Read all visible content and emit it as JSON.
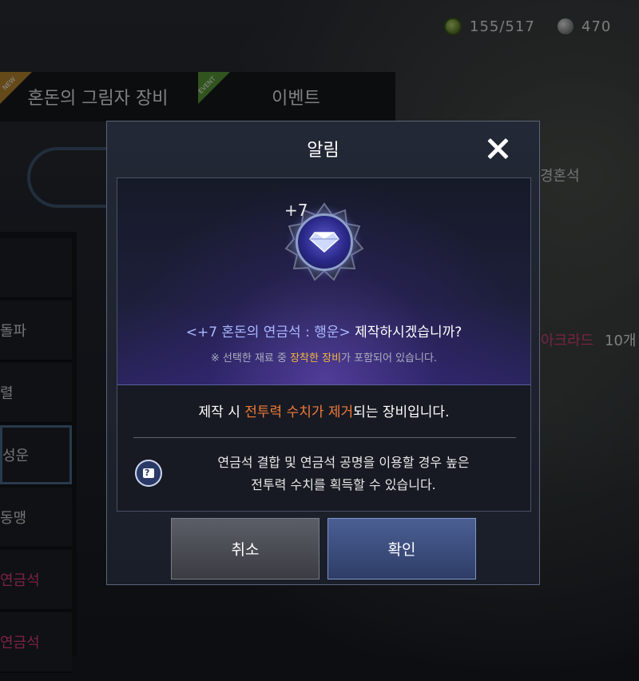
{
  "resources": {
    "stamina": "155/517",
    "silver": "470"
  },
  "tabs": [
    {
      "label": "혼돈의 그림자 장비",
      "badge": "NEW"
    },
    {
      "label": "이벤트",
      "badge": "EVENT"
    }
  ],
  "background": {
    "subtab_right": "경혼석",
    "right_item_name": "아크라드",
    "right_item_count": "10개",
    "left_items": [
      "돌파",
      "렬",
      "성운",
      "동맹",
      "연금석",
      "연금석"
    ]
  },
  "modal": {
    "title": "알림",
    "item_plus": "+7",
    "question_prefix": "<+7 혼돈의 연금석 : 행운>",
    "question_suffix": " 제작하시겠습니까?",
    "note_prefix": "※ 선택한 재료 중 ",
    "note_highlight": "장착한 장비",
    "note_suffix": "가 포함되어 있습니다.",
    "warn_prefix": "제작 시 ",
    "warn_highlight": "전투력 수치가 제거",
    "warn_suffix": "되는 장비입니다.",
    "tip_line1": "연금석 결합 및 연금석 공명을 이용할 경우 높은",
    "tip_line2": "전투력 수치를 획득할 수 있습니다.",
    "cancel_label": "취소",
    "ok_label": "확인"
  },
  "colors": {
    "highlight_orange": "#f07a3a",
    "highlight_yellow": "#f2b640",
    "item_name_blue": "#a9b8ff",
    "pink": "#e0407a"
  }
}
